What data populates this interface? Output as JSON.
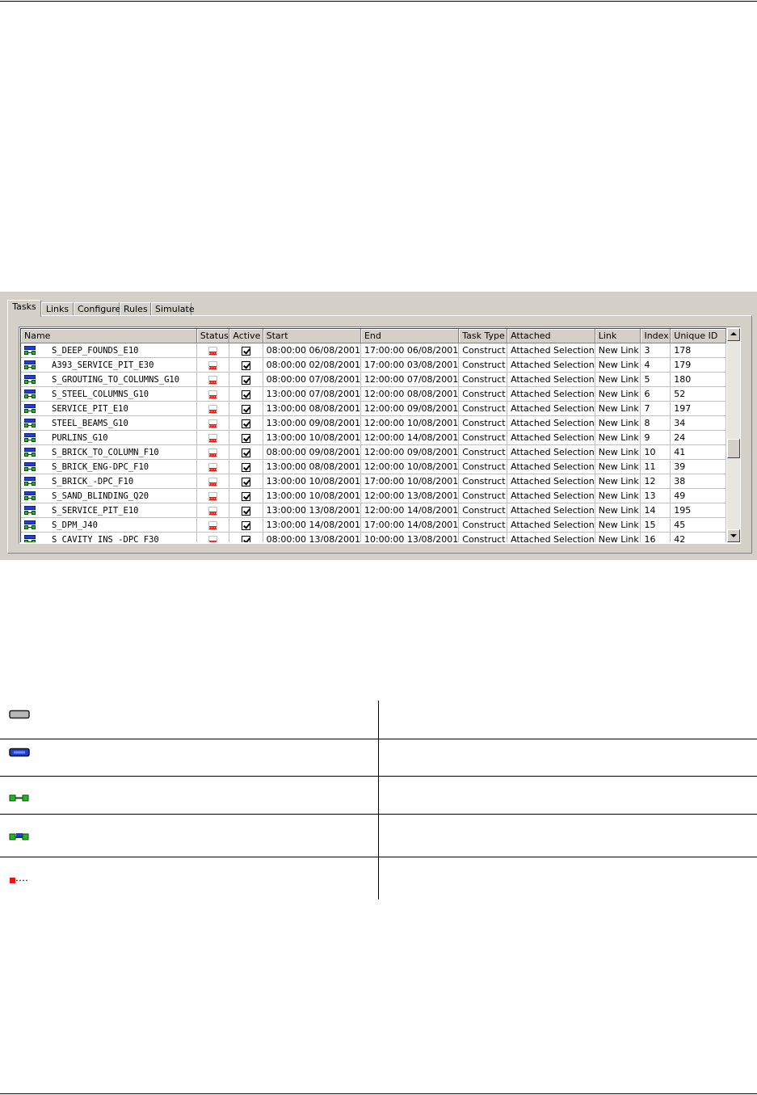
{
  "tabs": [
    {
      "label": "Tasks",
      "active": true
    },
    {
      "label": "Links",
      "active": false
    },
    {
      "label": "Configure",
      "active": false
    },
    {
      "label": "Rules",
      "active": false
    },
    {
      "label": "Simulate",
      "active": false
    }
  ],
  "grid": {
    "columns": [
      "Name",
      "Status",
      "Active",
      "Start",
      "End",
      "Task Type",
      "Attached",
      "Link",
      "Index",
      "Unique ID"
    ],
    "rows": [
      {
        "name": "S_DEEP_FOUNDS_E10",
        "start": "08:00:00 06/08/2001",
        "end": "17:00:00 06/08/2001",
        "task_type": "Construct",
        "attached": "Attached Selection",
        "link": "New Link",
        "index": "3",
        "uid": "178"
      },
      {
        "name": "A393_SERVICE_PIT_E30",
        "start": "08:00:00 02/08/2001",
        "end": "17:00:00 03/08/2001",
        "task_type": "Construct",
        "attached": "Attached Selection",
        "link": "New Link",
        "index": "4",
        "uid": "179"
      },
      {
        "name": "S_GROUTING_TO_COLUMNS_G10",
        "start": "08:00:00 07/08/2001",
        "end": "12:00:00 07/08/2001",
        "task_type": "Construct",
        "attached": "Attached Selection",
        "link": "New Link",
        "index": "5",
        "uid": "180"
      },
      {
        "name": "S_STEEL_COLUMNS_G10",
        "start": "13:00:00 07/08/2001",
        "end": "12:00:00 08/08/2001",
        "task_type": "Construct",
        "attached": "Attached Selection",
        "link": "New Link",
        "index": "6",
        "uid": "52"
      },
      {
        "name": "SERVICE_PIT_E10",
        "start": "13:00:00 08/08/2001",
        "end": "12:00:00 09/08/2001",
        "task_type": "Construct",
        "attached": "Attached Selection",
        "link": "New Link",
        "index": "7",
        "uid": "197"
      },
      {
        "name": "STEEL_BEAMS_G10",
        "start": "13:00:00 09/08/2001",
        "end": "12:00:00 10/08/2001",
        "task_type": "Construct",
        "attached": "Attached Selection",
        "link": "New Link",
        "index": "8",
        "uid": "34"
      },
      {
        "name": "PURLINS_G10",
        "start": "13:00:00 10/08/2001",
        "end": "12:00:00 14/08/2001",
        "task_type": "Construct",
        "attached": "Attached Selection",
        "link": "New Link",
        "index": "9",
        "uid": "24"
      },
      {
        "name": "S_BRICK_TO_COLUMN_F10",
        "start": "08:00:00 09/08/2001",
        "end": "12:00:00 09/08/2001",
        "task_type": "Construct",
        "attached": "Attached Selection",
        "link": "New Link",
        "index": "10",
        "uid": "41"
      },
      {
        "name": "S_BRICK_ENG-DPC_F10",
        "start": "13:00:00 08/08/2001",
        "end": "12:00:00 10/08/2001",
        "task_type": "Construct",
        "attached": "Attached Selection",
        "link": "New Link",
        "index": "11",
        "uid": "39"
      },
      {
        "name": "S_BRICK_-DPC_F10",
        "start": "13:00:00 10/08/2001",
        "end": "17:00:00 10/08/2001",
        "task_type": "Construct",
        "attached": "Attached Selection",
        "link": "New Link",
        "index": "12",
        "uid": "38"
      },
      {
        "name": "S_SAND_BLINDING_Q20",
        "start": "13:00:00 10/08/2001",
        "end": "12:00:00 13/08/2001",
        "task_type": "Construct",
        "attached": "Attached Selection",
        "link": "New Link",
        "index": "13",
        "uid": "49"
      },
      {
        "name": "S_SERVICE_PIT_E10",
        "start": "13:00:00 13/08/2001",
        "end": "12:00:00 14/08/2001",
        "task_type": "Construct",
        "attached": "Attached Selection",
        "link": "New Link",
        "index": "14",
        "uid": "195"
      },
      {
        "name": "S_DPM_J40",
        "start": "13:00:00 14/08/2001",
        "end": "17:00:00 14/08/2001",
        "task_type": "Construct",
        "attached": "Attached Selection",
        "link": "New Link",
        "index": "15",
        "uid": "45"
      },
      {
        "name": "S_CAVITY_INS_-DPC_F30",
        "start": "08:00:00 13/08/2001",
        "end": "10:00:00 13/08/2001",
        "task_type": "Construct",
        "attached": "Attached Selection",
        "link": "New Link",
        "index": "16",
        "uid": "42"
      }
    ]
  },
  "legend": [
    {
      "icon": "grey-bar-icon"
    },
    {
      "icon": "blue-bar-icon"
    },
    {
      "icon": "green-link-icon"
    },
    {
      "icon": "green-blue-link-icon"
    },
    {
      "icon": "red-dashed-icon"
    }
  ],
  "colors": {
    "panel": "#d4d0c8",
    "blue": "#1f3fd8",
    "green": "#21b81f",
    "red": "#e01818"
  }
}
